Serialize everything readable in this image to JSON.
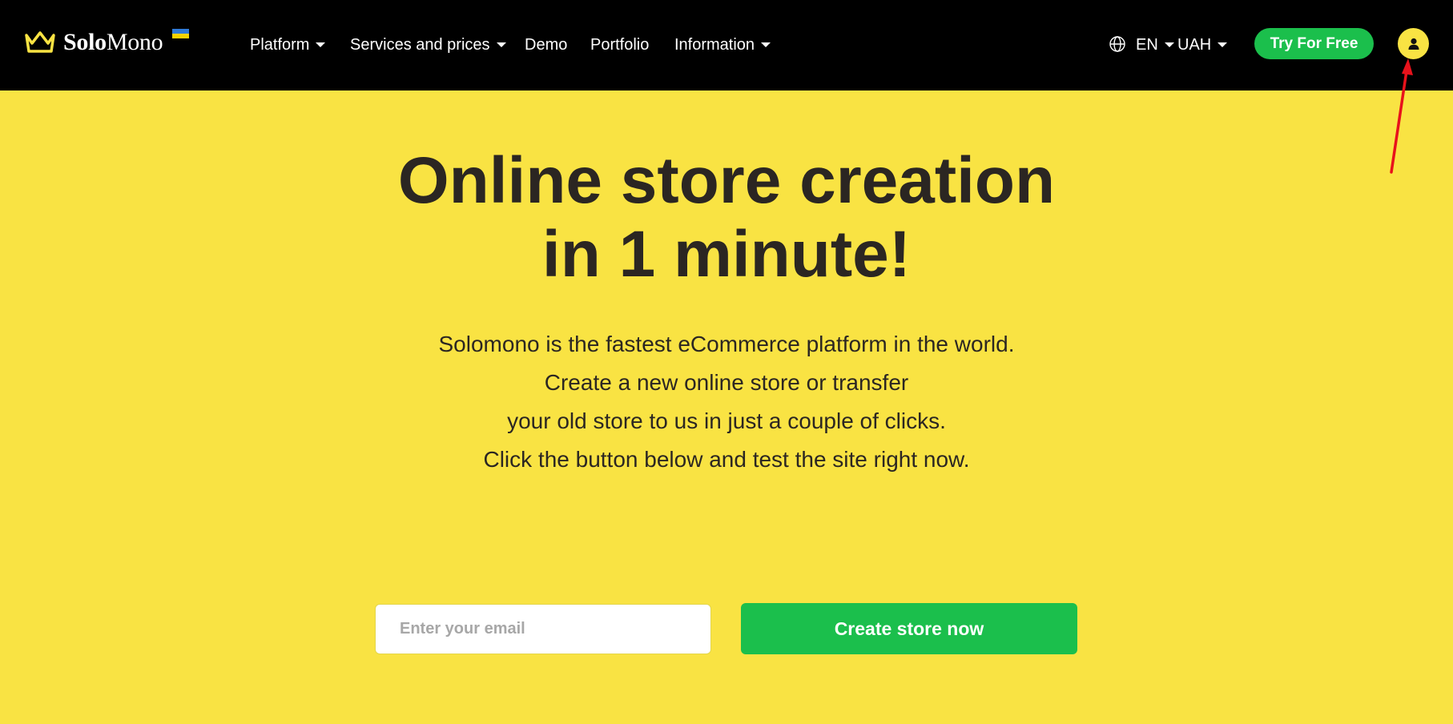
{
  "brand": {
    "name_bold": "Solo",
    "name_regular": "Mono"
  },
  "nav": {
    "items": [
      {
        "label": "Platform",
        "has_dropdown": true
      },
      {
        "label": "Services and prices",
        "has_dropdown": true
      },
      {
        "label": "Demo",
        "has_dropdown": false
      },
      {
        "label": "Portfolio",
        "has_dropdown": false
      },
      {
        "label": "Information",
        "has_dropdown": true
      }
    ]
  },
  "header_right": {
    "globe_icon": "globe-icon",
    "language": "EN",
    "currency": "UAH",
    "try_button": "Try For Free",
    "account_icon": "user-icon"
  },
  "hero": {
    "title_line1": "Online store creation",
    "title_line2": "in 1 minute!",
    "desc_lines": [
      "Solomono is the fastest eCommerce platform in the world.",
      "Create a new online store or transfer",
      "your old store to us in just a couple of clicks.",
      "Click the button below and test the site right now."
    ],
    "email_placeholder": "Enter your email",
    "email_value": "",
    "cta_label": "Create store now"
  },
  "colors": {
    "header_bg": "#000000",
    "page_bg": "#f9e343",
    "accent_green": "#1bbf4c",
    "text_dark": "#2b2622",
    "annotation_red": "#e8121b",
    "flag_blue": "#2f7ad7",
    "flag_yellow": "#f6d200"
  }
}
